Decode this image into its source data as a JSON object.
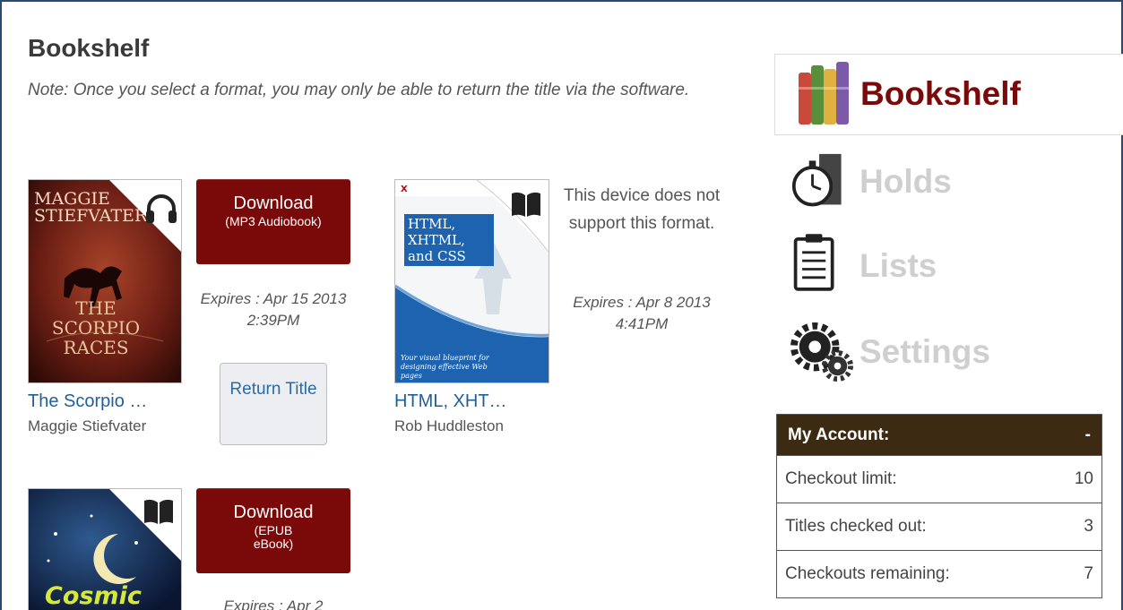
{
  "header": {
    "title": "Bookshelf",
    "note": "Note: Once you select a format, you may only be able to return the title via the software."
  },
  "books": [
    {
      "cover_title": "MAGGIE STIEFVATER",
      "cover_sub": "THE SCORPIO RACES",
      "media_icon": "headphones-icon",
      "title": "The Scorpio …",
      "author": "Maggie Stiefvater",
      "download_label": "Download",
      "download_format": "(MP3 Audiobook)",
      "expires": "Expires :  Apr 15 2013 2:39PM",
      "return_label": "Return Title"
    },
    {
      "cover_title": "HTML, XHTML, and CSS",
      "cover_sub": "Your visual blueprint for designing effective Web pages",
      "media_icon": "book-icon",
      "title": "HTML, XHT…",
      "author": "Rob Huddleston",
      "unsupported": "This device does not support this format.",
      "expires": "Expires :  Apr 8 2013 4:41PM"
    },
    {
      "cover_title": "Cosmic",
      "media_icon": "book-icon",
      "download_label": "Download",
      "download_format": "(EPUB eBook)",
      "expires": "Expires :  Apr 2"
    }
  ],
  "nav": {
    "bookshelf": "Bookshelf",
    "holds": "Holds",
    "lists": "Lists",
    "settings": "Settings"
  },
  "account": {
    "header": "My Account:",
    "toggle": "-",
    "rows": [
      {
        "label": "Checkout limit:",
        "value": "10"
      },
      {
        "label": "Titles checked out:",
        "value": "3"
      },
      {
        "label": "Checkouts remaining:",
        "value": "7"
      }
    ]
  },
  "colors": {
    "accent": "#7a0a0a",
    "link": "#1f5f9a",
    "account_header": "#3d2a12",
    "frame_border": "#2b4a70"
  }
}
